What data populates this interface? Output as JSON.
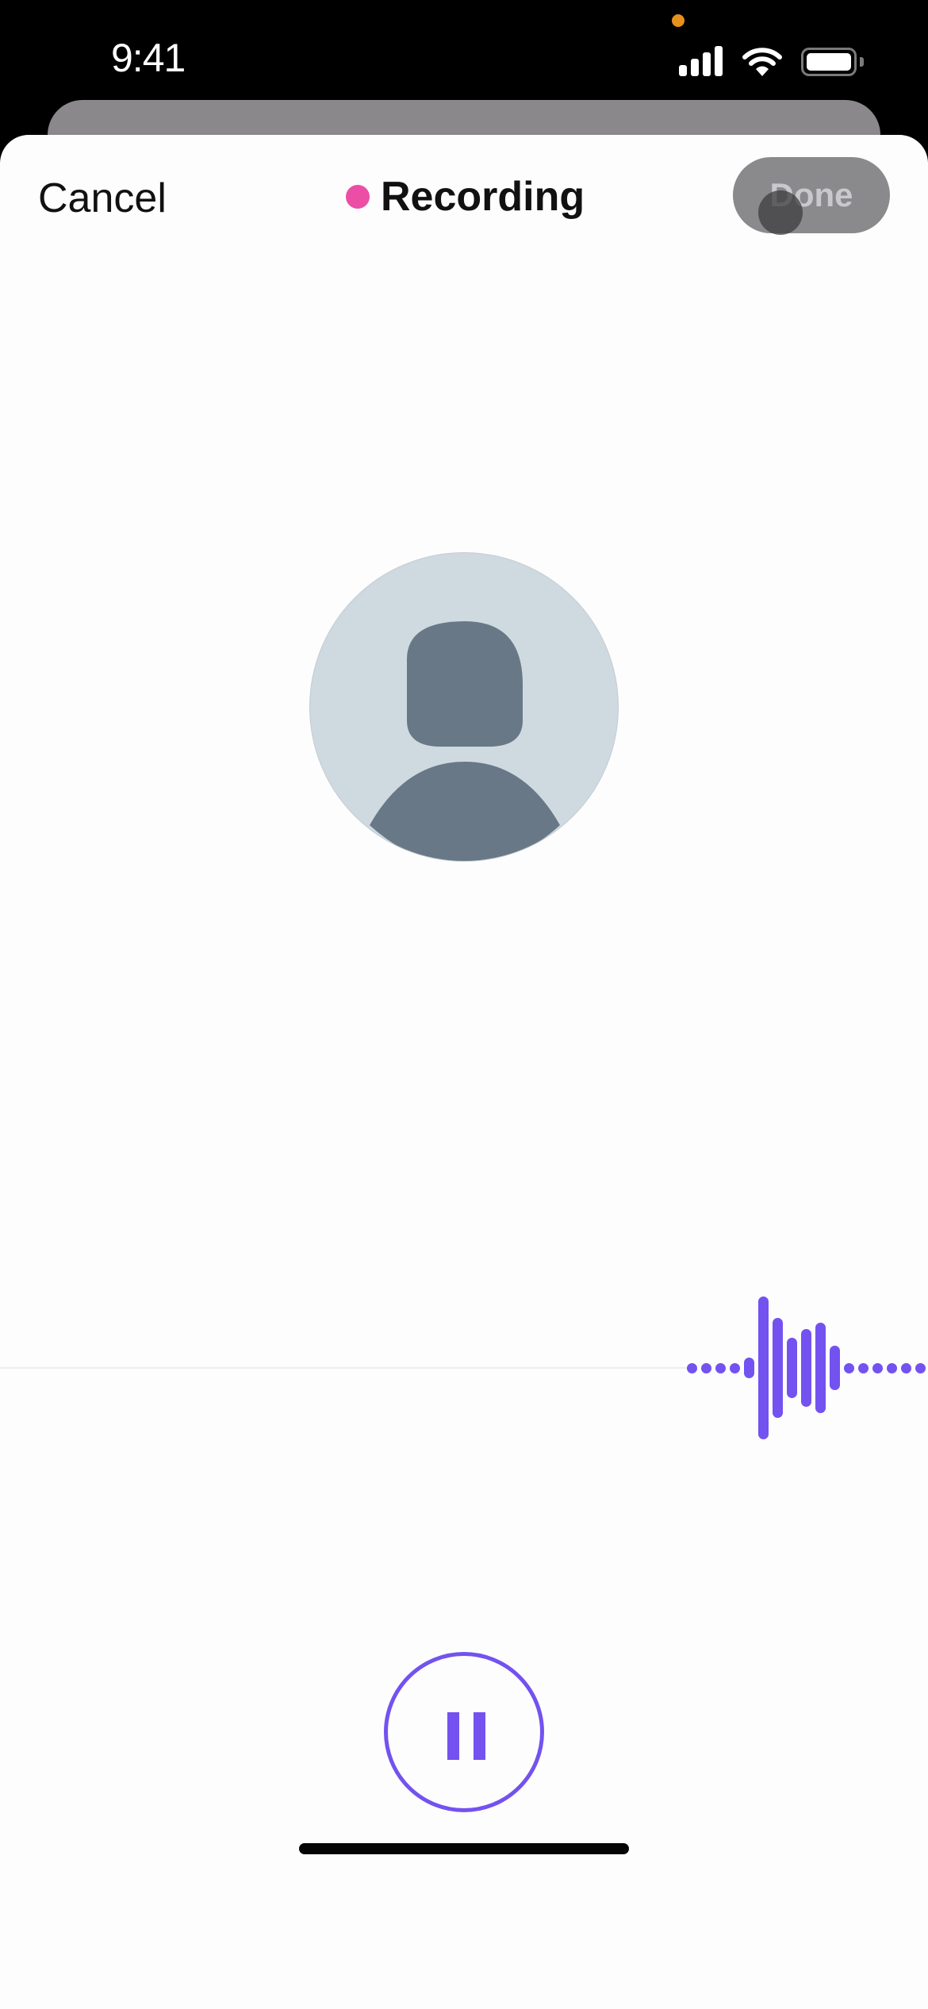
{
  "status_bar": {
    "time": "9:41",
    "privacy_indicator_color": "#e8901c",
    "icons": [
      "cellular-signal-icon",
      "wifi-icon",
      "battery-icon"
    ]
  },
  "header": {
    "cancel_label": "Cancel",
    "title": "Recording",
    "recording_indicator_color": "#ec4ea6",
    "done_label": "Done",
    "done_enabled": false
  },
  "avatar": {
    "type": "default-profile-placeholder",
    "background_color": "#cfd9e0",
    "silhouette_color": "#687887"
  },
  "waveform": {
    "color": "#7352f0",
    "amplitudes": [
      0,
      0,
      0,
      0,
      0.14,
      1.0,
      0.7,
      0.42,
      0.54,
      0.63,
      0.31,
      0,
      0,
      0,
      0,
      0,
      0
    ]
  },
  "controls": {
    "pause_icon": "pause-icon",
    "accent_color": "#7352f0"
  }
}
